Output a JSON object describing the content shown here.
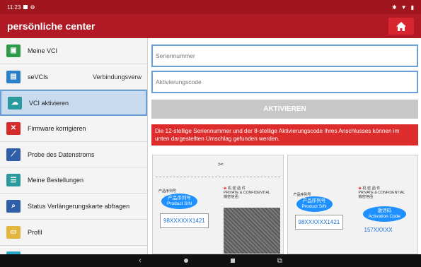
{
  "status": {
    "time": "11:23"
  },
  "header": {
    "title": "persönliche center"
  },
  "sidebar": {
    "items": [
      {
        "label": "Meine VCI",
        "icon": "vci-icon"
      },
      {
        "label": "seVCIs",
        "sub": "Verbindungsverw",
        "icon": "device-icon"
      },
      {
        "label": "VCI aktivieren",
        "icon": "cloud-icon"
      },
      {
        "label": "Firmware korrigieren",
        "icon": "tools-icon"
      },
      {
        "label": "Probe des Datenstroms",
        "icon": "chart-icon"
      },
      {
        "label": "Meine Bestellungen",
        "icon": "orders-icon"
      },
      {
        "label": "Status Verlängerungskarte abfragen",
        "icon": "search-icon"
      },
      {
        "label": "Profil",
        "icon": "profile-icon"
      }
    ]
  },
  "form": {
    "serial_placeholder": "Seriennummer",
    "code_placeholder": "Aktivierungscode",
    "activate_label": "AKTIVIEREN",
    "notice": "Die 12-stellige Seriennummer und der 8-stellige Aktivierungscode Ihres Anschlusses können im unten dargestellten Umschlag gefunden werden."
  },
  "card1": {
    "cn_label": "产品序列号",
    "bubble_cn": "产品序列号",
    "bubble_en": "Product S/N",
    "sn": "98XXXXXX1421",
    "seal_cn": "机 密 函 件",
    "seal_en": "PRIVATE & CONFIDENTIAL",
    "seal_sub": "機密信函"
  },
  "card2": {
    "cn_label": "产品序列号",
    "bubble_cn": "产品序列号",
    "bubble_en": "Product S/N",
    "sn": "98XXXXXX1421",
    "seal_cn": "机 密 函 件",
    "seal_en": "PRIVATE & CONFIDENTIAL",
    "seal_sub": "機密信函",
    "act_cn": "激活码",
    "act_en": "Activation Code",
    "act_code": "157XXXXX"
  },
  "colors": {
    "brand": "#b11a24",
    "accent": "#6a9fd6",
    "notice": "#dd2c2c"
  }
}
